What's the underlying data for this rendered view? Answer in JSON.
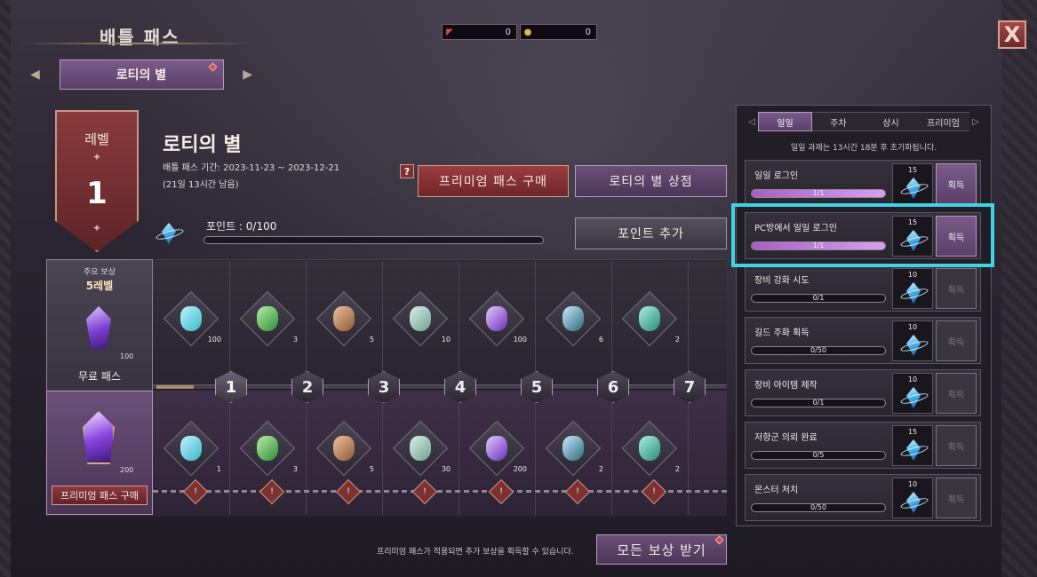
{
  "header": {
    "title": "배틀 패스",
    "season_tab": "로티의 별"
  },
  "currency": [
    {
      "icon": "ticket-icon",
      "value": "0"
    },
    {
      "icon": "coin-icon",
      "value": "0"
    }
  ],
  "season": {
    "level_label": "레벨",
    "level": "1",
    "name": "로티의 별",
    "period": "배틀 패스 기간: 2023-11-23 ~ 2023-12-21",
    "remaining": "(21일 13시간 남음)"
  },
  "buttons": {
    "help": "?",
    "premium_buy": "프리미엄 패스 구매",
    "shop": "로티의 별 상점",
    "add_points": "포인트 추가",
    "claim_all": "모든 보상 받기"
  },
  "points": {
    "label": "포인트 : 0/100",
    "current": 0,
    "max": 100
  },
  "main_reward": {
    "label": "주요 보상",
    "level": "5레벨",
    "free_count": "100",
    "free_label": "무료 패스",
    "premium_count": "200",
    "premium_buy": "프리미엄 패스 구매"
  },
  "levels": [
    "1",
    "2",
    "3",
    "4",
    "5",
    "6",
    "7"
  ],
  "free_items": [
    {
      "icon": "leaf-crystal-icon",
      "count": "100"
    },
    {
      "icon": "potion-icon",
      "count": "3"
    },
    {
      "icon": "ore-icon",
      "count": "5"
    },
    {
      "icon": "tent-icon",
      "count": "10"
    },
    {
      "icon": "purple-crystal-icon",
      "count": "100"
    },
    {
      "icon": "tools-orb-icon",
      "count": "6"
    },
    {
      "icon": "teal-scroll-icon",
      "count": "2"
    }
  ],
  "premium_items": [
    {
      "icon": "chest-icon",
      "count": "1"
    },
    {
      "icon": "potion-icon",
      "count": "3"
    },
    {
      "icon": "ore-icon",
      "count": "5"
    },
    {
      "icon": "tent-icon",
      "count": "30"
    },
    {
      "icon": "purple-crystal-icon",
      "count": "200"
    },
    {
      "icon": "tools-orb-icon",
      "count": "2"
    },
    {
      "icon": "teal-scroll-icon",
      "count": "2"
    }
  ],
  "lock_symbol": "!",
  "note": "프리미엄 패스가 적용되면 추가 보상을 획득할 수 있습니다.",
  "mission_panel": {
    "tabs": [
      "일일",
      "주차",
      "상시",
      "프리미엄"
    ],
    "reset": "일일 과제는 13시간 18분 후 초기화됩니다.",
    "missions": [
      {
        "name": "일일 로그인",
        "progress": "1/1",
        "fraction": 1,
        "reward": "15",
        "claim": "획득",
        "claimable": true
      },
      {
        "name": "PC방에서 일일 로그인",
        "progress": "1/1",
        "fraction": 1,
        "reward": "15",
        "claim": "획득",
        "claimable": true
      },
      {
        "name": "장비 강화 시도",
        "progress": "0/1",
        "fraction": 0,
        "reward": "10",
        "claim": "획득",
        "claimable": false
      },
      {
        "name": "길드 주화 획득",
        "progress": "0/50",
        "fraction": 0,
        "reward": "10",
        "claim": "획득",
        "claimable": false
      },
      {
        "name": "장비 아이템 제작",
        "progress": "0/1",
        "fraction": 0,
        "reward": "10",
        "claim": "획득",
        "claimable": false
      },
      {
        "name": "저항군 의뢰 완료",
        "progress": "0/5",
        "fraction": 0,
        "reward": "15",
        "claim": "획득",
        "claimable": false
      },
      {
        "name": "몬스터 처치",
        "progress": "0/50",
        "fraction": 0,
        "reward": "10",
        "claim": "획득",
        "claimable": false
      }
    ]
  },
  "colors": {
    "accent_purple": "#7a5a8a",
    "premium_red": "#9c3e3e",
    "highlight": "#3fd3e6"
  }
}
